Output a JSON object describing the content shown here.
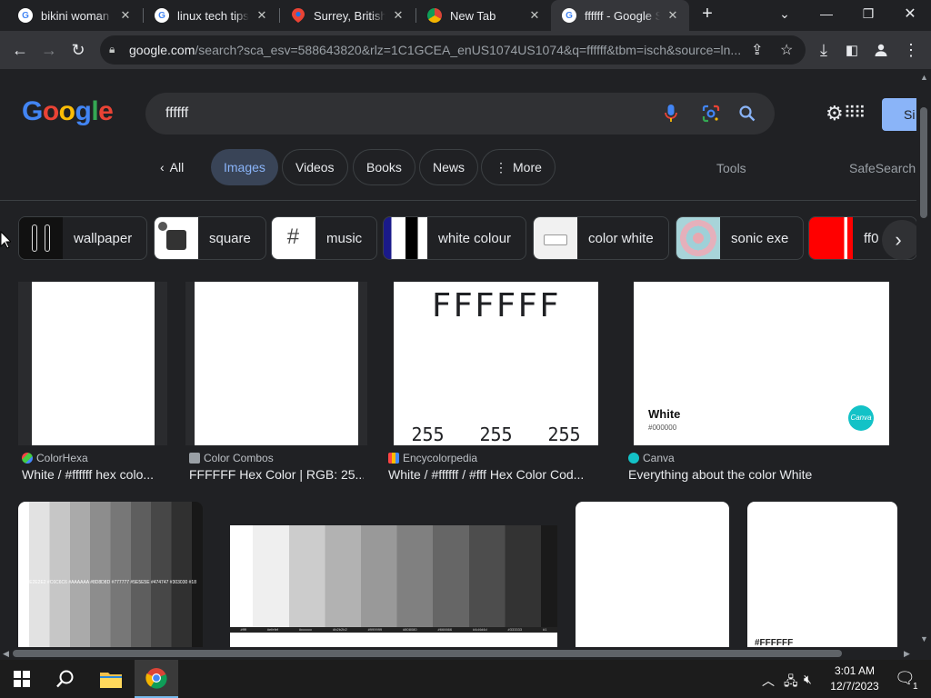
{
  "browser": {
    "tabs": [
      {
        "title": "bikini woman - ",
        "favicon": "google-favicon",
        "active": false
      },
      {
        "title": "linux tech tips | ",
        "favicon": "google-favicon",
        "active": false
      },
      {
        "title": "Surrey, British C",
        "favicon": "maps-favicon",
        "active": false
      },
      {
        "title": "New Tab",
        "favicon": "chrome-favicon",
        "active": false
      },
      {
        "title": "ffffff - Google S",
        "favicon": "google-favicon",
        "active": true
      }
    ],
    "url_host": "google.com",
    "url_path": "/search?sca_esv=588643820&rlz=1C1GCEA_enUS1074US1074&q=ffffff&tbm=isch&source=ln..."
  },
  "google": {
    "logo_letters": [
      "G",
      "o",
      "o",
      "g",
      "l",
      "e"
    ],
    "query": "ffffff",
    "signin_label": "Si",
    "filters": {
      "all": "All",
      "images": "Images",
      "videos": "Videos",
      "books": "Books",
      "news": "News",
      "more": "More",
      "tools": "Tools",
      "safesearch": "SafeSearch"
    },
    "related": [
      "wallpaper",
      "square",
      "music",
      "white colour",
      "color white",
      "sonic exe",
      "ff0"
    ],
    "results": [
      {
        "source": "ColorHexa",
        "caption": "White / #ffffff hex colo..."
      },
      {
        "source": "Color Combos",
        "caption": "FFFFFF Hex Color | RGB: 25..."
      },
      {
        "source": "Encycolorpedia",
        "caption": "White / #ffffff / #fff Hex Color Cod...",
        "image_title": "FFFFFF",
        "rgb": [
          "255",
          "255",
          "255"
        ]
      },
      {
        "source": "Canva",
        "caption": "Everything about the color White",
        "card_title": "White",
        "card_hex": "#000000",
        "brand": "Canva"
      }
    ],
    "row2": {
      "strip_labels": "#ffff  #E2E2E2  #C6C6C6  #AAAAAA  #8D8D8D  #777777  #5E5E5E  #474747  #303030  #18",
      "palette_labels": [
        "#ffff",
        "#efefef",
        "#cccccc",
        "#b2b2b2",
        "#999999",
        "#808080",
        "#666666",
        "#4d4d4d",
        "#333333",
        "#1"
      ],
      "last_card_label": "#FFFFFF"
    }
  },
  "taskbar": {
    "time": "3:01 AM",
    "date": "12/7/2023",
    "notification_count": "1"
  }
}
